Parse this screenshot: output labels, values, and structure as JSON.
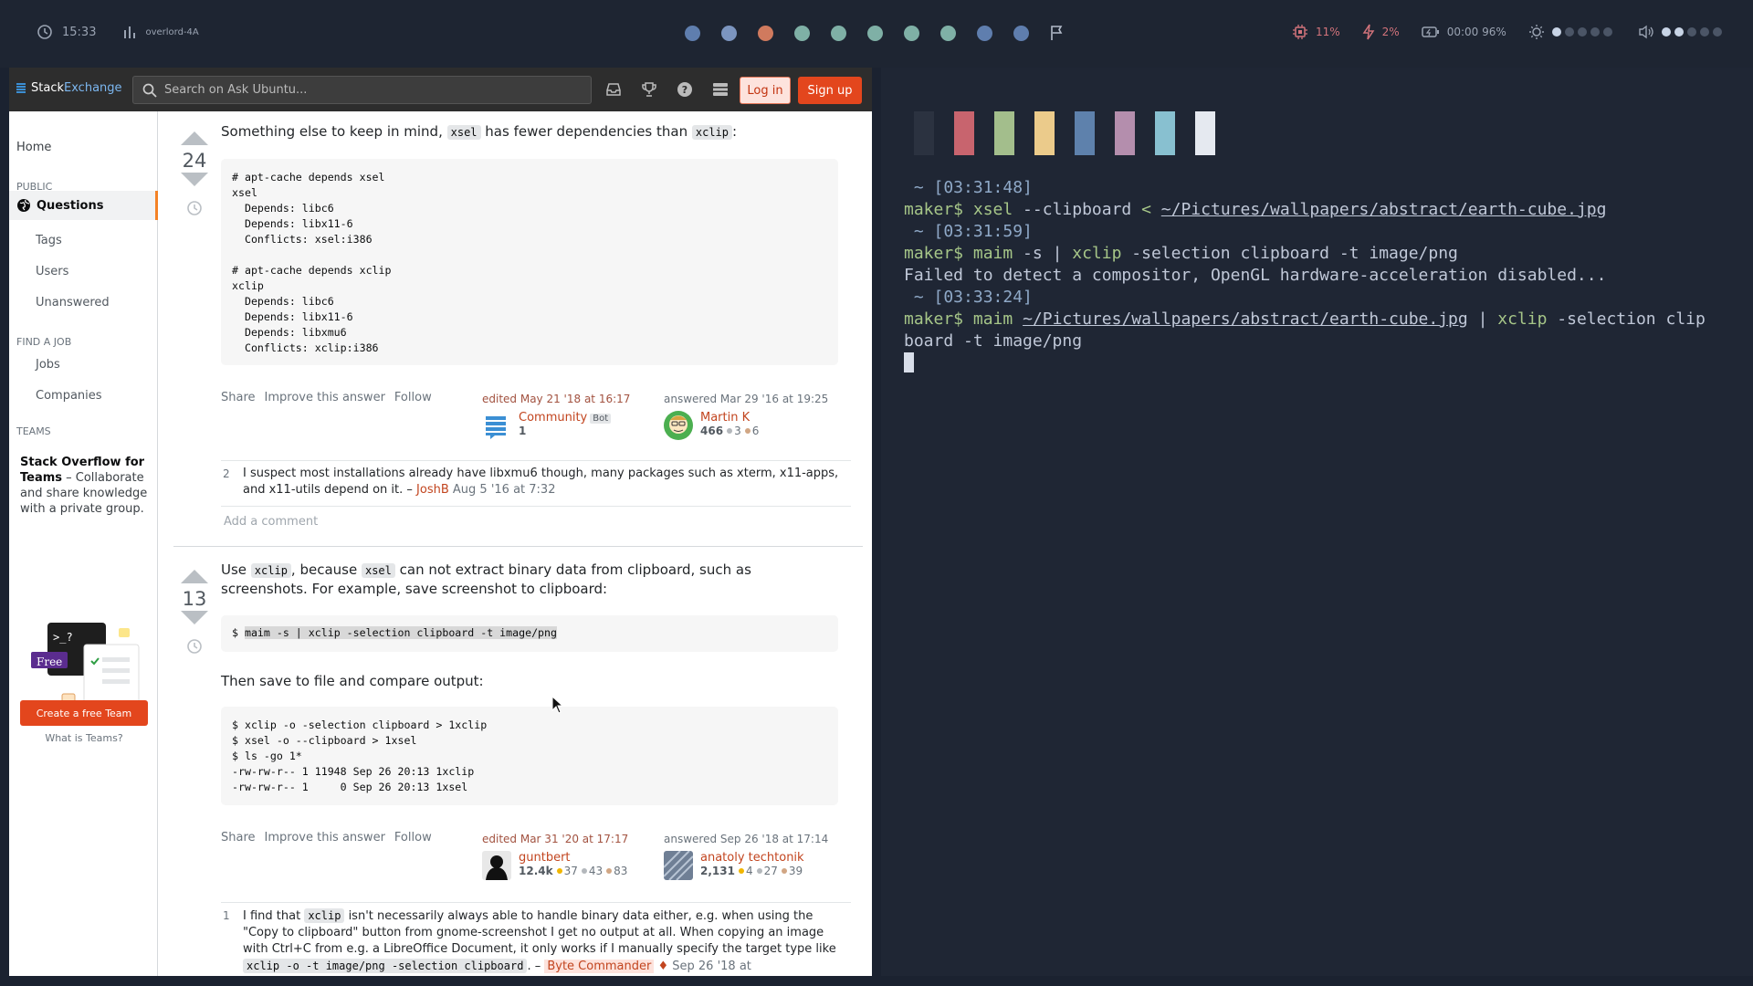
{
  "topbar": {
    "time": "15:33",
    "host": "overlord-4A",
    "workspaces": [
      "#5f7eae",
      "#7c95bf",
      "#d07a5e",
      "#7fb0a6",
      "#7fb0a6",
      "#7fb0a6",
      "#7fb0a6",
      "#7fb0a6",
      "#5f7eae",
      "#5f7eae"
    ],
    "cpu": "11%",
    "power": "2%",
    "battery": "00:00 96%",
    "brightness_level": 1,
    "volume_level": 2
  },
  "browser": {
    "logo_stack": "Stack",
    "logo_exchange": "Exchange",
    "search_placeholder": "Search on Ask Ubuntu...",
    "login": "Log in",
    "signup": "Sign up"
  },
  "nav": {
    "home": "Home",
    "public": "PUBLIC",
    "questions": "Questions",
    "tags": "Tags",
    "users": "Users",
    "unanswered": "Unanswered",
    "find_job": "FIND A JOB",
    "jobs": "Jobs",
    "companies": "Companies",
    "teams": "TEAMS",
    "teams_title": "Stack Overflow for Teams",
    "teams_desc": " – Collaborate and share knowledge with a private group.",
    "free": "Free",
    "create_team": "Create a free Team",
    "what_teams": "What is Teams?"
  },
  "answer1": {
    "score": "24",
    "text_pre": "Something else to keep in mind, ",
    "code1": "xsel",
    "text_mid": " has fewer dependencies than ",
    "code2": "xclip",
    "text_post": ":",
    "block": "# apt-cache depends xsel\nxsel\n  Depends: libc6\n  Depends: libx11-6\n  Conflicts: xsel:i386\n\n# apt-cache depends xclip\nxclip\n  Depends: libc6\n  Depends: libx11-6\n  Depends: libxmu6\n  Conflicts: xclip:i386",
    "share": "Share",
    "improve": "Improve this answer",
    "follow": "Follow",
    "edited": "edited May 21 '18 at 16:17",
    "editor": "Community",
    "editor_tag": "Bot",
    "editor_rep": "1",
    "answered": "answered Mar 29 '16 at 19:25",
    "author": "Martin K",
    "author_rep": "466",
    "author_silver": "3",
    "author_bronze": "6",
    "comment_votes": "2",
    "comment_text": "I suspect most installations already have libxmu6 though, many packages such as xterm, x11-apps, and x11-utils depend on it. – ",
    "comment_user": "JoshB",
    "comment_date": "Aug 5 '16 at 7:32",
    "add_comment": "Add a comment"
  },
  "answer2": {
    "score": "13",
    "t1": "Use ",
    "c1": "xclip",
    "t2": ", because ",
    "c2": "xsel",
    "t3": " can not extract binary data from clipboard, such as screenshots. For example, save screenshot to clipboard:",
    "block1_prompt": "$ ",
    "block1_cmd": "maim -s | xclip -selection clipboard -t image/png",
    "then": "Then save to file and compare output:",
    "block2": "$ xclip -o -selection clipboard > 1xclip\n$ xsel -o --clipboard > 1xsel\n$ ls -go 1*\n-rw-rw-r-- 1 11948 Sep 26 20:13 1xclip\n-rw-rw-r-- 1     0 Sep 26 20:13 1xsel",
    "share": "Share",
    "improve": "Improve this answer",
    "follow": "Follow",
    "edited": "edited Mar 31 '20 at 17:17",
    "editor": "guntbert",
    "editor_rep": "12.4k",
    "editor_gold": "37",
    "editor_silver": "43",
    "editor_bronze": "83",
    "answered": "answered Sep 26 '18 at 17:14",
    "author": "anatoly techtonik",
    "author_rep": "2,131",
    "author_gold": "4",
    "author_silver": "27",
    "author_bronze": "39",
    "comment_votes": "1",
    "comment_t1": "I find that ",
    "comment_c1": "xclip",
    "comment_t2": " isn't necessarily always able to handle binary data either, e.g. when using the \"Copy to clipboard\" button from gnome-screenshot I get no output at all. When copying an image with Ctrl+C from e.g. a LibreOffice Document, it only works if I manually specify the target type like ",
    "comment_c2": "xclip -o -t image/png -selection clipboard",
    "comment_t3": ". – ",
    "comment_user": "Byte Commander",
    "comment_date": "Sep 26 '18 at"
  },
  "terminal": {
    "swatches": [
      "#2b3240",
      "#c8646e",
      "#a3be8c",
      "#ebcb8b",
      "#5e81ac",
      "#b48ead",
      "#88c0d0",
      "#e5e9f0"
    ],
    "l1": " ~ [03:31:48]",
    "l2_prompt": "maker$ ",
    "l2_cmd": "xsel",
    "l2_args": " --clipboard ",
    "l2_op": "<",
    "l2_sp": " ",
    "l2_path": "~/Pictures/wallpapers/abstract/earth-cube.jpg",
    "l3": " ~ [03:31:59]",
    "l4_prompt": "maker$ ",
    "l4_cmd": "maim",
    "l4_a": " -s | ",
    "l4_cmd2": "xclip",
    "l4_b": " -selection clipboard -t image/png",
    "l5": "Failed to detect a compositor, OpenGL hardware-acceleration disabled...",
    "l6": " ~ [03:33:24]",
    "l7_prompt": "maker$ ",
    "l7_cmd": "maim",
    "l7_sp": " ",
    "l7_path": "~/Pictures/wallpapers/abstract/earth-cube.jpg",
    "l7_pipe": " | ",
    "l7_cmd2": "xclip",
    "l7_rest": " -selection clip",
    "l8": "board -t image/png"
  }
}
